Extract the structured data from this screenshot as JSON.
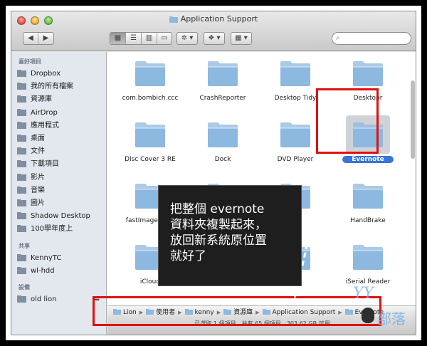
{
  "window": {
    "title": "Application Support"
  },
  "toolbar": {
    "back_label": "◀",
    "forward_label": "▶",
    "view_icons": "▦",
    "view_list": "☰",
    "view_columns": "▥",
    "view_coverflow": "▭",
    "action_label": "✲ ▾",
    "dropbox_label": "❖ ▾",
    "arrange_label": "▦ ▾",
    "search_placeholder": ""
  },
  "sidebar": {
    "favorites_heading": "喜好項目",
    "favorites": [
      {
        "label": "Dropbox",
        "icon": "folder-icon"
      },
      {
        "label": "我的所有檔案",
        "icon": "all-files-icon"
      },
      {
        "label": "資源庫",
        "icon": "folder-icon"
      },
      {
        "label": "AirDrop",
        "icon": "airdrop-icon"
      },
      {
        "label": "應用程式",
        "icon": "applications-icon"
      },
      {
        "label": "桌面",
        "icon": "desktop-icon"
      },
      {
        "label": "文件",
        "icon": "documents-icon"
      },
      {
        "label": "下載項目",
        "icon": "downloads-icon"
      },
      {
        "label": "影片",
        "icon": "movies-icon"
      },
      {
        "label": "音樂",
        "icon": "music-icon"
      },
      {
        "label": "圖片",
        "icon": "pictures-icon"
      },
      {
        "label": "Shadow Desktop",
        "icon": "folder-icon"
      },
      {
        "label": "100學年度上",
        "icon": "folder-icon"
      }
    ],
    "shared_heading": "共享",
    "shared": [
      {
        "label": "KennyTC",
        "icon": "computer-icon"
      },
      {
        "label": "wl-hdd",
        "icon": "computer-icon"
      }
    ],
    "devices_heading": "設備",
    "devices": [
      {
        "label": "old lion",
        "icon": "disk-icon",
        "eject": "⏏"
      }
    ]
  },
  "files": [
    {
      "name": "com.bombich.ccc"
    },
    {
      "name": "CrashReporter"
    },
    {
      "name": "Desktop Tidy"
    },
    {
      "name": "Desktopr"
    },
    {
      "name": "Disc Cover 3 RE"
    },
    {
      "name": "Dock"
    },
    {
      "name": "DVD Player"
    },
    {
      "name": "Evernote",
      "selected": true
    },
    {
      "name": "fastImageResiz"
    },
    {
      "name": ""
    },
    {
      "name": ""
    },
    {
      "name": "HandBrake"
    },
    {
      "name": "iCloud"
    },
    {
      "name": ""
    },
    {
      "name": "ut"
    },
    {
      "name": "iSerial Reader"
    },
    {
      "name": ""
    },
    {
      "name": ""
    },
    {
      "name": ""
    },
    {
      "name": ""
    }
  ],
  "pathbar": {
    "crumbs": [
      "Lion",
      "使用者",
      "kenny",
      "資源庫",
      "Application Support",
      "Evernote"
    ]
  },
  "statusbar": {
    "text": "已選取 1 個項目，共有 65 個項目，303.62 GB 可用"
  },
  "callout": {
    "lines": [
      "把整個 evernote",
      "資料夾複製起來，",
      "放回新系統原位置",
      "就好了"
    ]
  },
  "watermark": {
    "logo": "YY",
    "text": "部落"
  },
  "colors": {
    "folder": "#8db8df",
    "selection": "#3875d7",
    "annotation": "#e01010"
  }
}
